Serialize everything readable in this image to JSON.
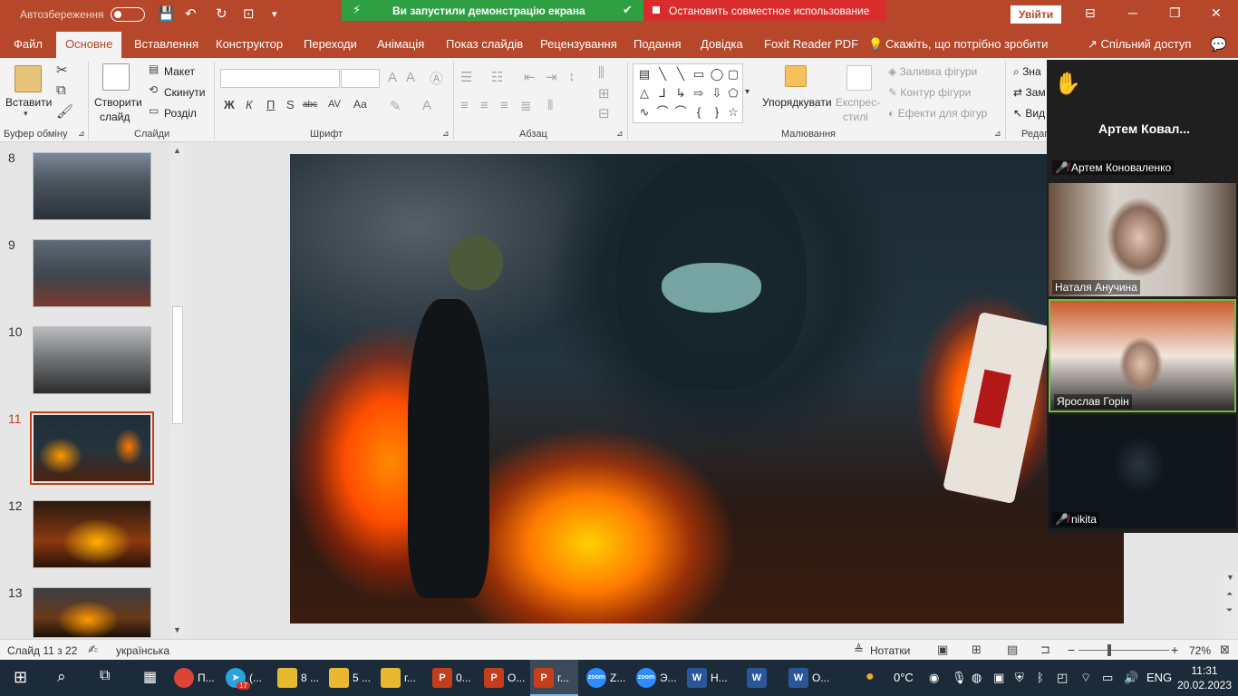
{
  "titlebar": {
    "autosave_label": "Автозбереження",
    "autosave_state": "off",
    "sharing_banner": "Ви запустили демонстрацію екрана",
    "stop_share": "Остановить совместное использование",
    "signin": "Увійти"
  },
  "ribbon_tabs": [
    "Файл",
    "Основне",
    "Вставлення",
    "Конструктор",
    "Переходи",
    "Анімація",
    "Показ слайдів",
    "Рецензування",
    "Подання",
    "Довідка",
    "Foxit Reader PDF"
  ],
  "active_tab": "Основне",
  "tell_me": "Скажіть, що потрібно зробити",
  "share": "Спільний доступ",
  "ribbon": {
    "clipboard": {
      "paste": "Вставити",
      "label": "Буфер обміну"
    },
    "slides": {
      "new_slide": "Створити",
      "new_slide2": "слайд",
      "layout": "Макет",
      "reset": "Скинути",
      "section": "Розділ",
      "label": "Слайди"
    },
    "font": {
      "label": "Шрифт",
      "bold": "Ж",
      "italic": "К",
      "underline": "П",
      "strike": "S",
      "spacing": "abc",
      "case": "Аа"
    },
    "paragraph": {
      "label": "Абзац"
    },
    "drawing": {
      "arrange": "Упорядкувати",
      "quick1": "Експрес-",
      "quick2": "стилі",
      "fill": "Заливка фігури",
      "outline": "Контур фігури",
      "effects": "Ефекти для фігур",
      "label": "Малювання"
    },
    "editing": {
      "find": "Зна",
      "replace": "Зам",
      "select": "Вид",
      "label": "Редаг"
    }
  },
  "slides_pane": {
    "items": [
      {
        "number": "8"
      },
      {
        "number": "9"
      },
      {
        "number": "10"
      },
      {
        "number": "11",
        "selected": true
      },
      {
        "number": "12"
      },
      {
        "number": "13"
      }
    ]
  },
  "zoom_panel": {
    "active_speaker": "Артем  Ковал...",
    "participants": [
      {
        "name": "Артем Коноваленко",
        "muted": true
      },
      {
        "name": "Наталя Анучина",
        "muted": false
      },
      {
        "name": "Ярослав Горін",
        "muted": false,
        "speaking": true
      },
      {
        "name": "nikita",
        "muted": true
      }
    ]
  },
  "statusbar": {
    "slide_info": "Слайд 11 з 22",
    "language": "українська",
    "notes": "Нотатки",
    "zoom_level": "72%",
    "minus": "−",
    "plus": "+"
  },
  "taskbar": {
    "apps": [
      {
        "icon": "chrome-icon",
        "label": "П...",
        "color": "#db4437"
      },
      {
        "icon": "telegram-icon",
        "label": "(...",
        "color": "#2aa3de",
        "badge": "17"
      },
      {
        "icon": "folder-icon",
        "label": "8 ...",
        "color": "#e8b830"
      },
      {
        "icon": "folder-icon",
        "label": "5 ...",
        "color": "#e8b830"
      },
      {
        "icon": "folder-icon",
        "label": "г...",
        "color": "#e8b830"
      },
      {
        "icon": "powerpoint-icon",
        "label": "0...",
        "color": "#c43e1c"
      },
      {
        "icon": "powerpoint-icon",
        "label": "О...",
        "color": "#c43e1c"
      },
      {
        "icon": "powerpoint-icon",
        "label": "г...",
        "color": "#c43e1c",
        "active": true
      },
      {
        "icon": "zoom-icon",
        "label": "Z...",
        "color": "#2d8cff"
      },
      {
        "icon": "zoom-icon",
        "label": "Э...",
        "color": "#2d8cff"
      },
      {
        "icon": "word-icon",
        "label": "Н...",
        "color": "#2b579a"
      },
      {
        "icon": "word-icon",
        "label": "",
        "color": "#2b579a"
      },
      {
        "icon": "word-icon",
        "label": "О...",
        "color": "#2b579a"
      }
    ],
    "weather": "0°C",
    "language": "ENG",
    "time": "11:31",
    "date": "20.02.2023"
  },
  "colors": {
    "accent": "#b7472a",
    "share_green": "#2ea043",
    "share_red": "#d92d2d"
  }
}
